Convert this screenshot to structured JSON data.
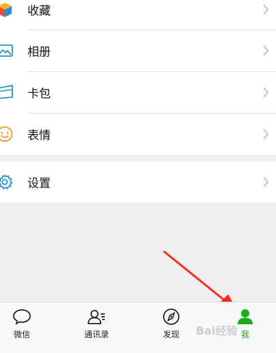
{
  "menu": {
    "items": [
      {
        "label": "收藏",
        "icon": "favorites-cube-icon"
      },
      {
        "label": "相册",
        "icon": "photo-album-icon"
      },
      {
        "label": "卡包",
        "icon": "card-wallet-icon"
      },
      {
        "label": "表情",
        "icon": "sticker-smiley-icon"
      }
    ],
    "settings": {
      "label": "设置",
      "icon": "gear-icon"
    }
  },
  "tabs": [
    {
      "label": "微信",
      "icon": "chat-bubble-icon"
    },
    {
      "label": "通讯录",
      "icon": "contacts-icon"
    },
    {
      "label": "发现",
      "icon": "compass-icon"
    },
    {
      "label": "我",
      "icon": "person-icon",
      "active": true
    }
  ],
  "colors": {
    "active": "#1aad19",
    "arrow": "#ff2a1a",
    "icon_blue": "#2a8fd6",
    "icon_orange": "#f29a1e",
    "icon_yellow": "#f4b51c",
    "icon_red": "#e8523a"
  },
  "watermark": "Bai经验"
}
